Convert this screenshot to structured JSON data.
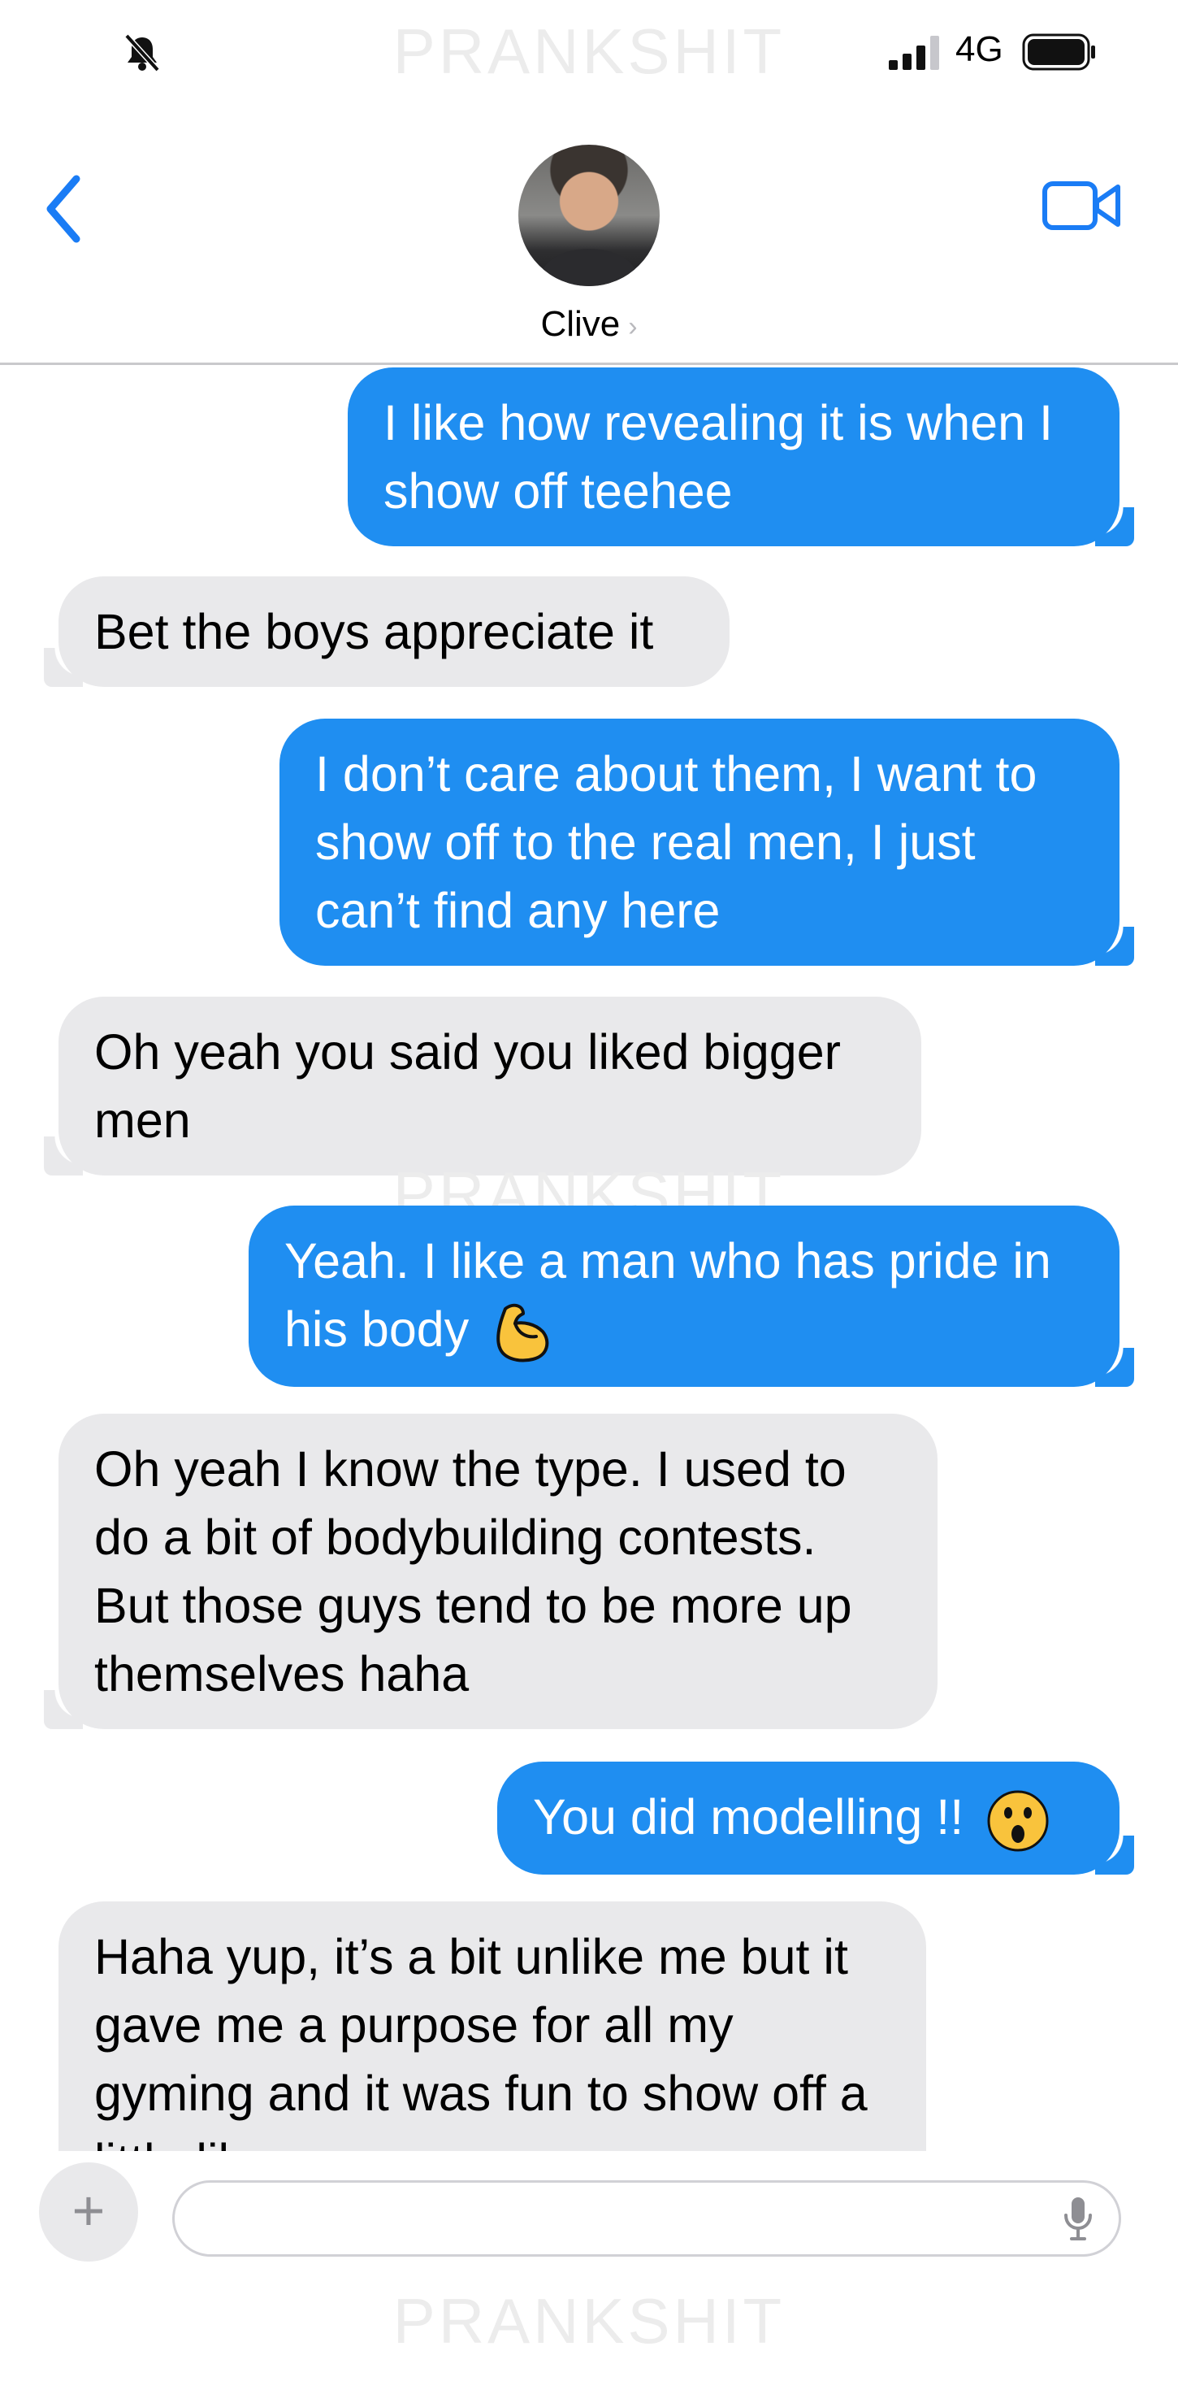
{
  "watermark": "PRANKSHIT",
  "status_bar": {
    "network": "4G"
  },
  "header": {
    "contact_name": "Clive"
  },
  "messages": [
    {
      "from": "me",
      "text": "I like how revealing it is when I show off teehee"
    },
    {
      "from": "them",
      "text": "Bet the boys appreciate it"
    },
    {
      "from": "me",
      "text": "I don’t care about them, I want to show off to the real men, I just can’t find any here"
    },
    {
      "from": "them",
      "text": "Oh yeah you said you liked bigger men"
    },
    {
      "from": "me",
      "text": "Yeah. I like a man who has pride in his body",
      "emoji": "flexed-biceps"
    },
    {
      "from": "them",
      "text": "Oh yeah I know the type. I used to do a bit of bodybuilding contests. But those guys tend to be more up themselves haha"
    },
    {
      "from": "me",
      "text": "You did modelling !!",
      "emoji": "astonished-face"
    },
    {
      "from": "them",
      "text": "Haha yup, it’s a bit unlike me but it gave me a purpose for all my gyming and it was fun to show off a little lik"
    }
  ],
  "colors": {
    "sent_bubble": "#1f8ef1",
    "received_bubble": "#e9e9eb",
    "accent": "#1a7cf5"
  }
}
